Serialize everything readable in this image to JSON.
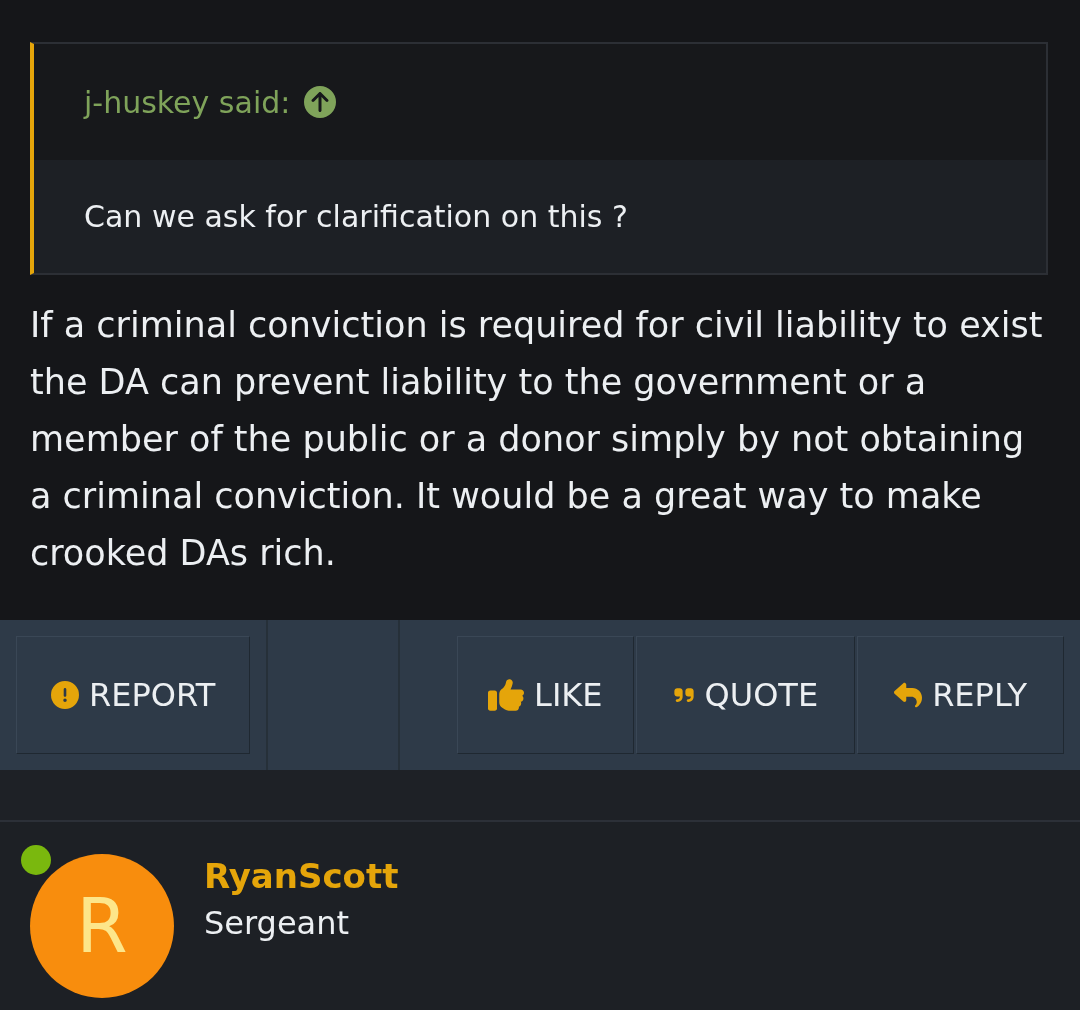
{
  "quote": {
    "attribution": "j-huskey said:",
    "text": "Can we ask for clarification on this ?"
  },
  "post": {
    "text": "If a criminal conviction is required for civil liability to exist the DA can prevent liability to the government or a member of the public or a donor simply by not obtaining a criminal conviction. It would be a great way to make crooked DAs rich."
  },
  "actions_left": [
    {
      "kind": "report",
      "label": "REPORT"
    }
  ],
  "actions_right": [
    {
      "kind": "like",
      "label": "LIKE"
    },
    {
      "kind": "quote",
      "label": "QUOTE"
    },
    {
      "kind": "reply",
      "label": "REPLY"
    }
  ],
  "next_post": {
    "initial": "R",
    "online": true,
    "username": "RyanScott",
    "user_title": "Sergeant"
  }
}
